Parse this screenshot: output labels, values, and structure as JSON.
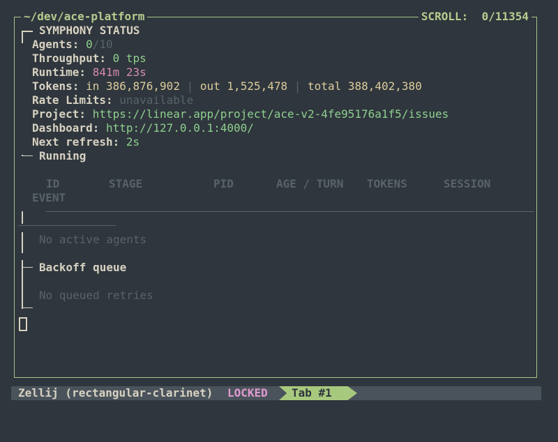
{
  "terminal": {
    "path": "~/dev/ace-platform",
    "scroll_label": "SCROLL:",
    "scroll_value": "0/11354"
  },
  "status": {
    "title": "SYMPHONY STATUS",
    "agents_label": "Agents:",
    "agents_value": "0",
    "agents_total": "/10",
    "throughput_label": "Throughput:",
    "throughput_value": "0 tps",
    "runtime_label": "Runtime:",
    "runtime_value": "841m 23s",
    "tokens_label": "Tokens:",
    "tokens_in_label": "in",
    "tokens_in_value": "386,876,902",
    "tokens_sep1": "|",
    "tokens_out_label": "out",
    "tokens_out_value": "1,525,478",
    "tokens_sep2": "|",
    "tokens_total_label": "total",
    "tokens_total_value": "388,402,380",
    "rate_limits_label": "Rate Limits:",
    "rate_limits_value": "unavailable",
    "project_label": "Project:",
    "project_value": "https://linear.app/project/ace-v2-4fe95176a1f5/issues",
    "dashboard_label": "Dashboard:",
    "dashboard_value": "http://127.0.0.1:4000/",
    "refresh_label": "Next refresh:",
    "refresh_value": "2s"
  },
  "running": {
    "title": "Running",
    "headers": [
      "ID",
      "STAGE",
      "PID",
      "AGE / TURN",
      "TOKENS",
      "SESSION"
    ],
    "event_header": "EVENT",
    "empty": "No active agents"
  },
  "backoff": {
    "title": "Backoff queue",
    "empty": "No queued retries"
  },
  "statusbar": {
    "session": "Zellij (rectangular-clarinet)",
    "locked": "LOCKED",
    "tab": "Tab #1"
  },
  "colors": {
    "background": "#2f363d",
    "border": "#a9c48a",
    "green_text": "#8fcf8f",
    "muted_text": "#59626b",
    "pink_text": "#d78bb1"
  }
}
